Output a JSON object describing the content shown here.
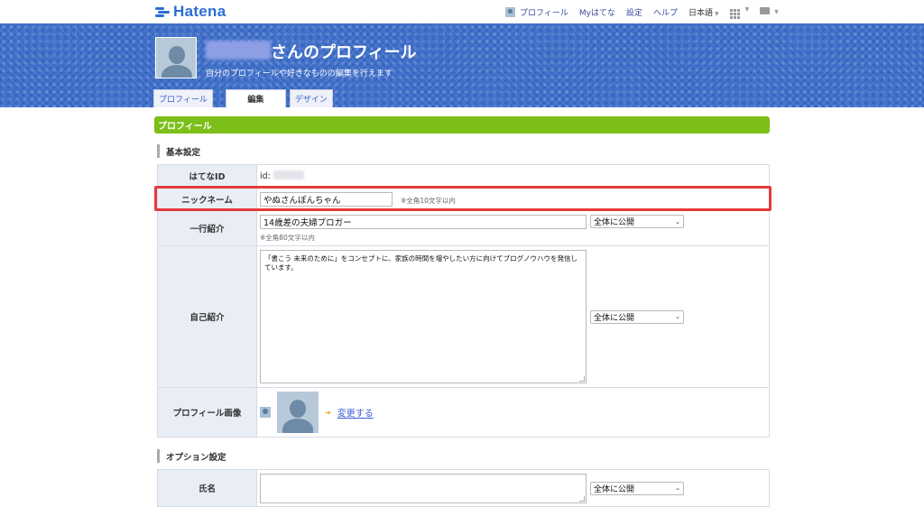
{
  "header": {
    "logo": "Hatena",
    "nav": {
      "profile": "プロフィール",
      "my_hatena": "Myはてな",
      "settings": "設定",
      "help": "ヘルプ",
      "language": "日本語"
    }
  },
  "banner": {
    "title": "さんのプロフィール",
    "subtitle": "自分のプロフィールや好きなものの編集を行えます"
  },
  "tabs": [
    {
      "label": "プロフィール",
      "active": false
    },
    {
      "label": "編集",
      "active": true
    },
    {
      "label": "デザイン",
      "active": false
    }
  ],
  "section": {
    "title": "プロフィール",
    "basic_heading": "基本設定",
    "option_heading": "オプション設定"
  },
  "rows": {
    "hatena_id": {
      "label": "はてなID",
      "value": "id:"
    },
    "nickname": {
      "label": "ニックネーム",
      "value": "やぬさんぽんちゃん",
      "note": "※全角10文字以内"
    },
    "one_line": {
      "label": "一行紹介",
      "value": "14歳差の夫婦ブロガー",
      "note": "※全角80文字以内",
      "visibility": "全体に公開"
    },
    "self_intro": {
      "label": "自己紹介",
      "value": "「書こう 未来のために」をコンセプトに、家族の時間を増やしたい方に向けてブログノウハウを発信しています。",
      "visibility": "全体に公開"
    },
    "profile_image": {
      "label": "プロフィール画像",
      "change_link": "変更する"
    },
    "name": {
      "label": "氏名",
      "value": "",
      "visibility": "全体に公開"
    }
  },
  "colors": {
    "section_green": "#7cbf18",
    "highlight_red": "#e43a3a",
    "banner_blue": "#3f6fc9"
  }
}
